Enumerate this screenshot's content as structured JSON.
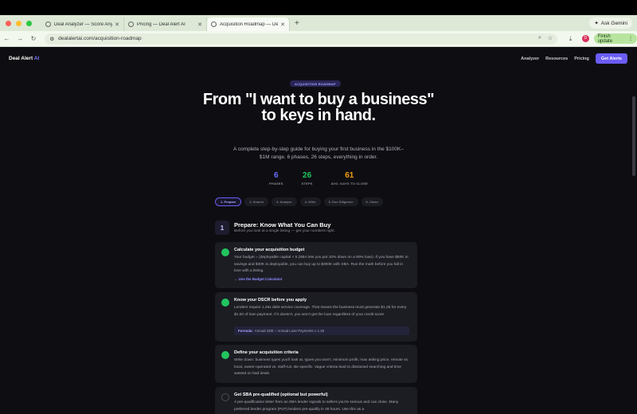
{
  "browser": {
    "tabs": [
      {
        "label": "Deal Analyzer — Score Any O"
      },
      {
        "label": "Pricing — Deal Alert AI"
      },
      {
        "label": "Acquisition Roadmap — Dea"
      }
    ],
    "ask_gemini": "Ask Gemini",
    "url": "dealalertai.com/acquisition-roadmap",
    "avatar_letter": "D",
    "finish_update": "Finish update",
    "colors": {
      "close": "#ff5f57",
      "min": "#ffbd2e",
      "max": "#28c840"
    }
  },
  "site": {
    "logo_main": "Deal Alert",
    "logo_ai": "AI",
    "nav": [
      "Analyzer",
      "Resources",
      "Pricing"
    ],
    "cta": "Get Alerts",
    "accent": "#6b5cf6"
  },
  "hero": {
    "pill": "ACQUISITION ROADMAP",
    "title": "From \"I want to buy a business\" to keys in hand.",
    "subtitle": "A complete step-by-step guide for buying your first business in the $100K–$1M range. 6 phases, 26 steps, everything in order."
  },
  "stats": [
    {
      "value": "6",
      "label": "PHASES",
      "color": "#6b6cff"
    },
    {
      "value": "26",
      "label": "STEPS",
      "color": "#22c55e"
    },
    {
      "value": "61",
      "label": "AVG. DAYS TO CLOSE",
      "color": "#f59e0b"
    }
  ],
  "step_tabs": [
    "1. Prepare",
    "2. Search",
    "3. Analyze",
    "4. Offer",
    "5. Due Diligence",
    "6. Close"
  ],
  "phase": {
    "number": "1",
    "title": "Prepare: Know What You Can Buy",
    "subtitle": "Before you look at a single listing — get your numbers right."
  },
  "cards": [
    {
      "title": "Calculate your acquisition budget",
      "body": "Your budget = (deployable capital × 5 (SBA lets you put 10% down on a 90% loan). If you have $50K in savings and $30K is deployable, you can buy up to $300K with SBA. Run the math before you fall in love with a listing.",
      "link": "→ Use the Budget Calculator",
      "done": true
    },
    {
      "title": "Know your DSCR before you apply",
      "body": "Lenders require 1.25x debt service coverage. That means the business must generate $1.25 for every $1.00 of loan payment. If it doesn't, you won't get the loan regardless of your credit score.",
      "formula_label": "Formula:",
      "formula": "Annual SDE ÷ Annual Loan Payments ≥ 1.25",
      "done": true
    },
    {
      "title": "Define your acquisition criteria",
      "body": "Write down: business types you'll look at, types you won't, minimum profit, max asking price, remote vs. local, owner-operated vs. staff-run. Be specific. Vague criteria lead to distracted searching and time wasted on bad deals.",
      "done": true
    },
    {
      "title": "Get SBA pre-qualified (optional but powerful)",
      "body": "A pre-qualification letter from an SBA lender signals to sellers you're serious and can close. Many preferred lender program (PLP) lenders pre-qualify in 48 hours. Use this as a",
      "done": false
    }
  ]
}
